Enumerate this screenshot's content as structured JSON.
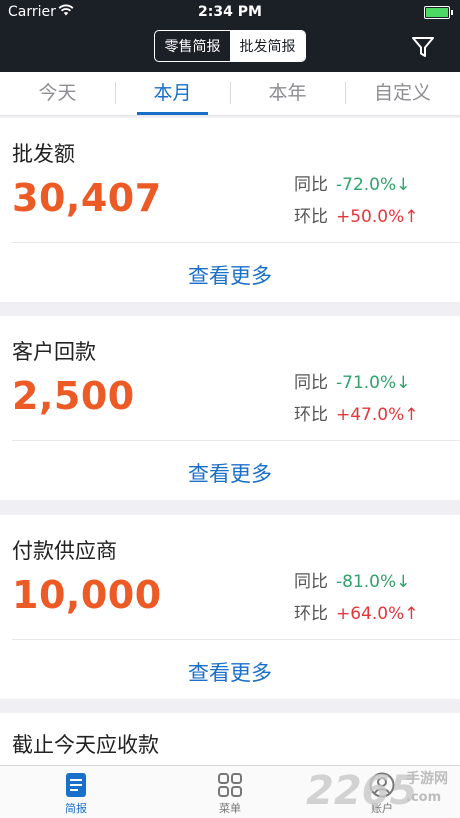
{
  "status_bar": {
    "carrier": "Carrier",
    "time": "2:34 PM",
    "battery_level": 1.0
  },
  "header": {
    "segments": [
      "零售简报",
      "批发简报"
    ],
    "active_segment": "批发简报",
    "filter_icon": "filter-icon"
  },
  "period_tabs": {
    "items": [
      "今天",
      "本月",
      "本年",
      "自定义"
    ],
    "active": "本月"
  },
  "cards": [
    {
      "title": "批发额",
      "value": "30,407",
      "yoy": {
        "label": "同比",
        "value": "-72.0%↓"
      },
      "mom": {
        "label": "环比",
        "value": "+50.0%↑"
      },
      "more": "查看更多"
    },
    {
      "title": "客户回款",
      "value": "2,500",
      "yoy": {
        "label": "同比",
        "value": "-71.0%↓"
      },
      "mom": {
        "label": "环比",
        "value": "+47.0%↑"
      },
      "more": "查看更多"
    },
    {
      "title": "付款供应商",
      "value": "10,000",
      "yoy": {
        "label": "同比",
        "value": "-81.0%↓"
      },
      "mom": {
        "label": "环比",
        "value": "+64.0%↑"
      },
      "more": "查看更多"
    },
    {
      "title": "截止今天应收款"
    }
  ],
  "tab_bar": {
    "items": [
      {
        "label": "简报",
        "icon": "report-icon"
      },
      {
        "label": "菜单",
        "icon": "menu-grid-icon"
      },
      {
        "label": "账户",
        "icon": "account-icon"
      }
    ],
    "active": "简报"
  },
  "watermark": {
    "number": "2265",
    "site": "手游网",
    "domain": ".com"
  },
  "colors": {
    "accent": "#1a6fc9",
    "value": "#ec5a25",
    "down": "#2ea36b",
    "up": "#e5373a",
    "header_bg": "#1b1f26"
  }
}
